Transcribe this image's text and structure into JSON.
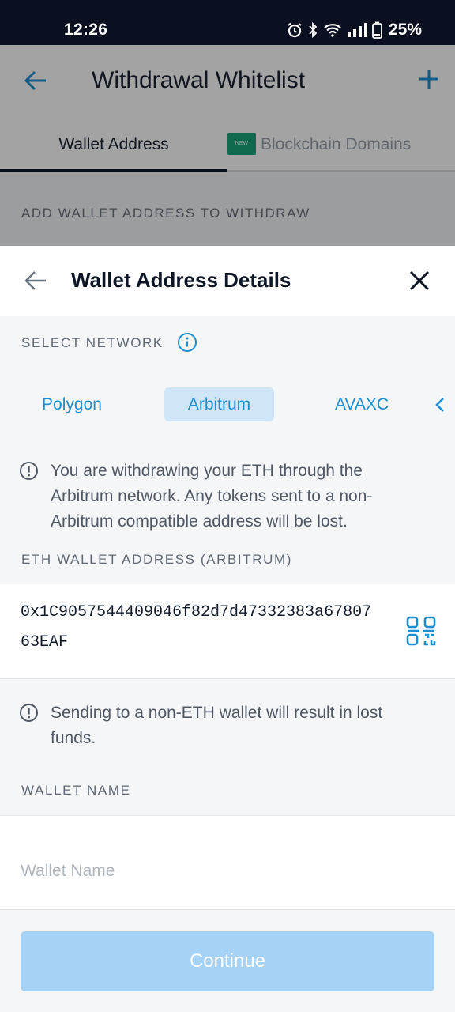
{
  "status_bar": {
    "time": "12:26",
    "battery": "25%",
    "icons": [
      "alarm-icon",
      "bluetooth-icon",
      "wifi-icon",
      "signal-icon",
      "battery-icon"
    ]
  },
  "background_page": {
    "title": "Withdrawal Whitelist",
    "tabs": [
      {
        "label": "Wallet Address",
        "active": true
      },
      {
        "label": "Blockchain Domains",
        "badge": "NEW",
        "active": false
      }
    ],
    "section_label": "ADD WALLET ADDRESS TO WITHDRAW"
  },
  "sheet": {
    "title": "Wallet Address Details",
    "select_network_label": "SELECT NETWORK",
    "networks": [
      {
        "label": "Polygon",
        "selected": false
      },
      {
        "label": "Arbitrum",
        "selected": true
      },
      {
        "label": "AVAXC",
        "selected": false
      }
    ],
    "network_warning": "You are withdrawing your ETH through the Arbitrum network. Any tokens sent to a non-Arbitrum compatible address will be lost.",
    "address_label": "ETH WALLET ADDRESS (ARBITRUM)",
    "address_value": "0x1C9057544409046f82d7d47332383a6780763EAF",
    "address_warning": "Sending to a non-ETH wallet will result in lost funds.",
    "wallet_name_label": "WALLET NAME",
    "wallet_name_placeholder": "Wallet Name",
    "wallet_name_value": "",
    "continue_label": "Continue"
  },
  "colors": {
    "accent": "#1d8fd1",
    "selected_chip": "#cfe6f7",
    "button_disabled": "#a6d3f5",
    "new_badge": "#1aa37a"
  }
}
